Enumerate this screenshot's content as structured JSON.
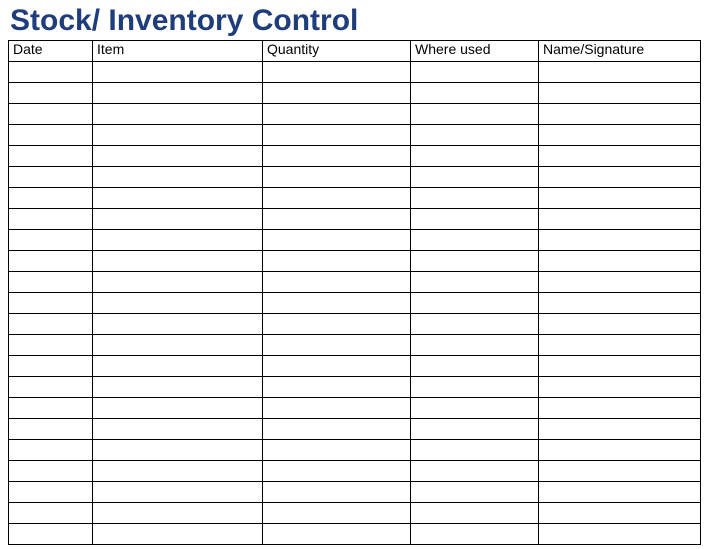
{
  "title": "Stock/ Inventory Control",
  "columns": {
    "date": "Date",
    "item": "Item",
    "quantity": "Quantity",
    "where_used": "Where used",
    "signature": "Name/Signature"
  },
  "row_count": 23
}
